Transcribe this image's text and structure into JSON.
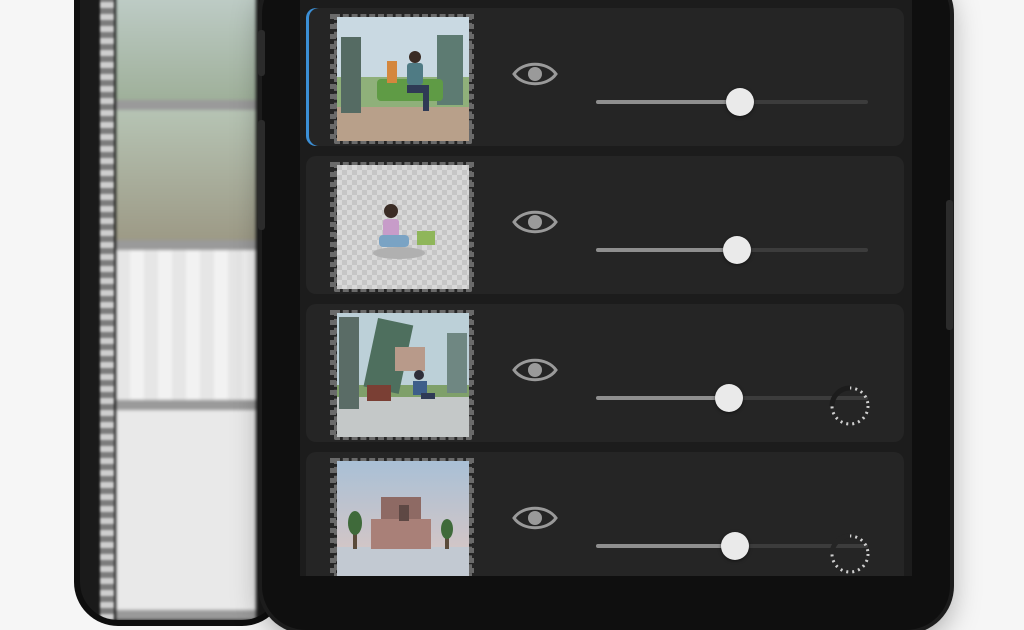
{
  "layers": [
    {
      "id": "layer-1",
      "selected": true,
      "opacity": 0.53,
      "loading": false,
      "visibility_icon": "eye-icon"
    },
    {
      "id": "layer-2",
      "selected": false,
      "opacity": 0.52,
      "loading": false,
      "visibility_icon": "eye-icon"
    },
    {
      "id": "layer-3",
      "selected": false,
      "opacity": 0.49,
      "loading": true,
      "visibility_icon": "eye-icon"
    },
    {
      "id": "layer-4",
      "selected": false,
      "opacity": 0.51,
      "loading": true,
      "visibility_icon": "eye-icon"
    }
  ],
  "colors": {
    "accent": "#3b8fd6",
    "panel": "#252525",
    "screen": "#1c1c1c",
    "knob": "#eaeaea"
  }
}
